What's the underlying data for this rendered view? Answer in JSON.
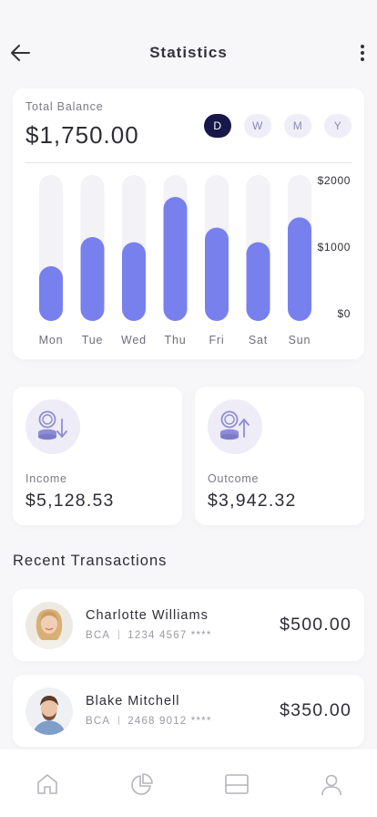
{
  "header": {
    "title": "Statistics",
    "back_icon": "arrow-left-icon",
    "more_icon": "more-vertical-icon"
  },
  "balance": {
    "label": "Total Balance",
    "value": "$1,750.00",
    "periods": [
      {
        "label": "D",
        "active": true
      },
      {
        "label": "W",
        "active": false
      },
      {
        "label": "M",
        "active": false
      },
      {
        "label": "Y",
        "active": false
      }
    ]
  },
  "chart_data": {
    "type": "bar",
    "categories": [
      "Mon",
      "Tue",
      "Wed",
      "Thu",
      "Fri",
      "Sat",
      "Sun"
    ],
    "values": [
      750,
      1150,
      1080,
      1700,
      1280,
      1080,
      1420
    ],
    "ylim": [
      0,
      2000
    ],
    "yticks": [
      "$2000",
      "$1000",
      "$0"
    ],
    "title": "",
    "xlabel": "",
    "ylabel": "",
    "grid": false,
    "colors": {
      "bar": "#7880ee",
      "track": "#f2f2f7"
    }
  },
  "stats": {
    "income": {
      "label": "Income",
      "value": "$5,128.53",
      "icon": "coins-down-icon"
    },
    "outcome": {
      "label": "Outcome",
      "value": "$3,942.32",
      "icon": "coins-up-icon"
    }
  },
  "recent": {
    "title": "Recent Transactions",
    "items": [
      {
        "name": "Charlotte Williams",
        "bank": "BCA",
        "account": "1234 4567 ****",
        "amount": "$500.00"
      },
      {
        "name": "Blake Mitchell",
        "bank": "BCA",
        "account": "2468 9012 ****",
        "amount": "$350.00"
      }
    ]
  },
  "tabbar": {
    "icons": [
      "home-icon",
      "pie-chart-icon",
      "card-icon",
      "profile-icon"
    ]
  },
  "colors": {
    "accent": "#7880ee",
    "dark": "#17184a",
    "icon_bg": "#edecf7"
  }
}
